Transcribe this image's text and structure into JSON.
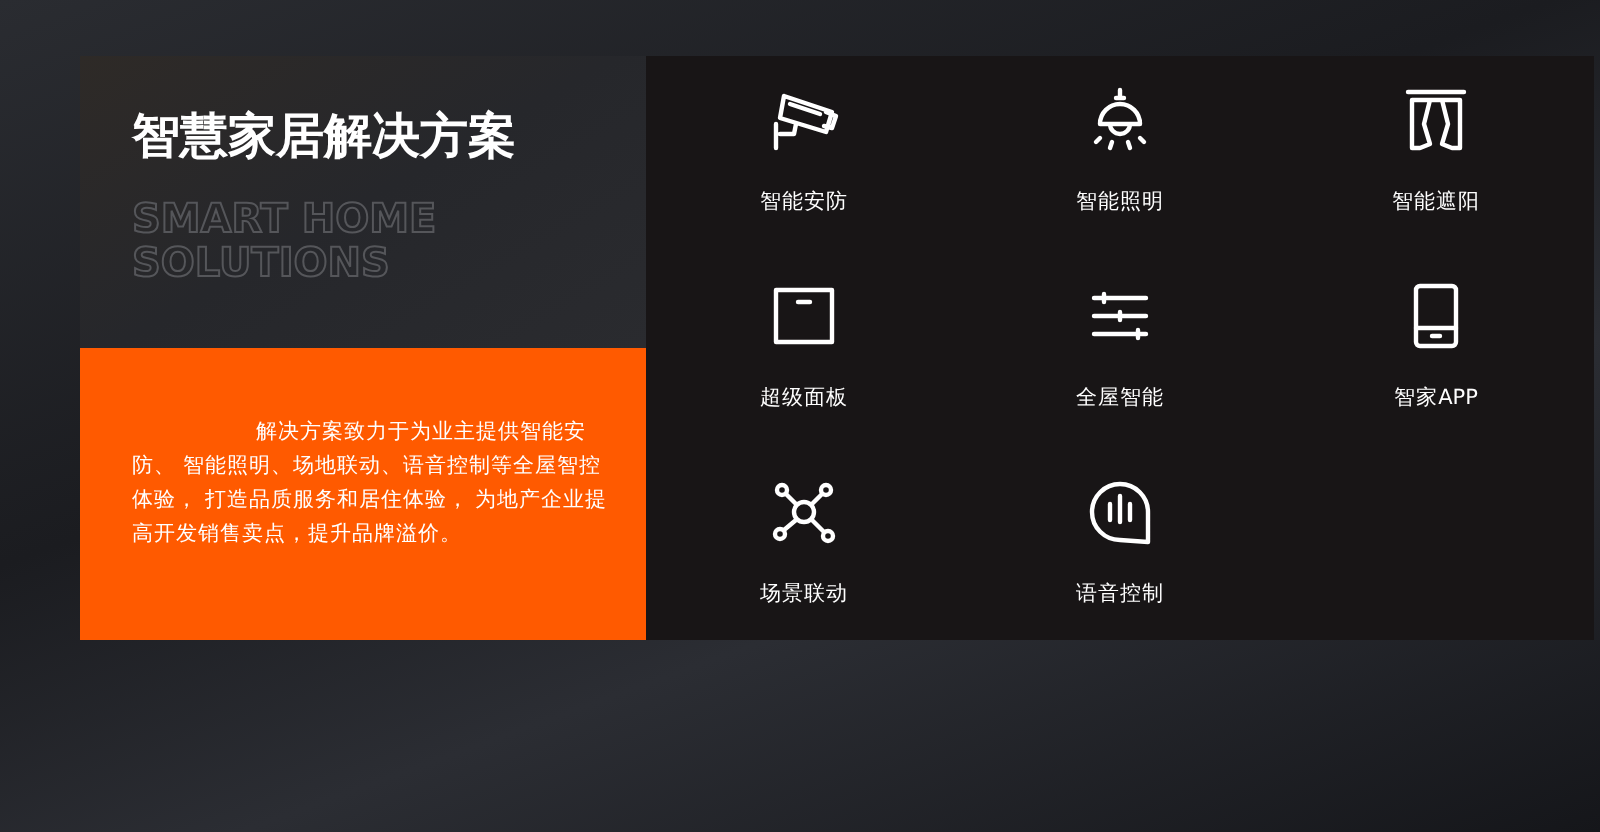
{
  "intro": {
    "title": "智慧家居解决方案",
    "subtitle_lines": [
      "SMART HOME",
      "SOLUTIONS"
    ],
    "description": "解决方案致力于为业主提供智能安防、 智能照明、场地联动、语音控制等全屋智控体验， 打造品质服务和居住体验， 为地产企业提高开发销售卖点，提升品牌溢价。"
  },
  "features": [
    {
      "kind": "camera",
      "label": "智能安防"
    },
    {
      "kind": "lamp",
      "label": "智能照明"
    },
    {
      "kind": "curtain",
      "label": "智能遮阳"
    },
    {
      "kind": "panel",
      "label": "超级面板"
    },
    {
      "kind": "sliders",
      "label": "全屋智能"
    },
    {
      "kind": "tablet",
      "label": "智家APP"
    },
    {
      "kind": "network",
      "label": "场景联动"
    },
    {
      "kind": "voice",
      "label": "语音控制"
    }
  ]
}
